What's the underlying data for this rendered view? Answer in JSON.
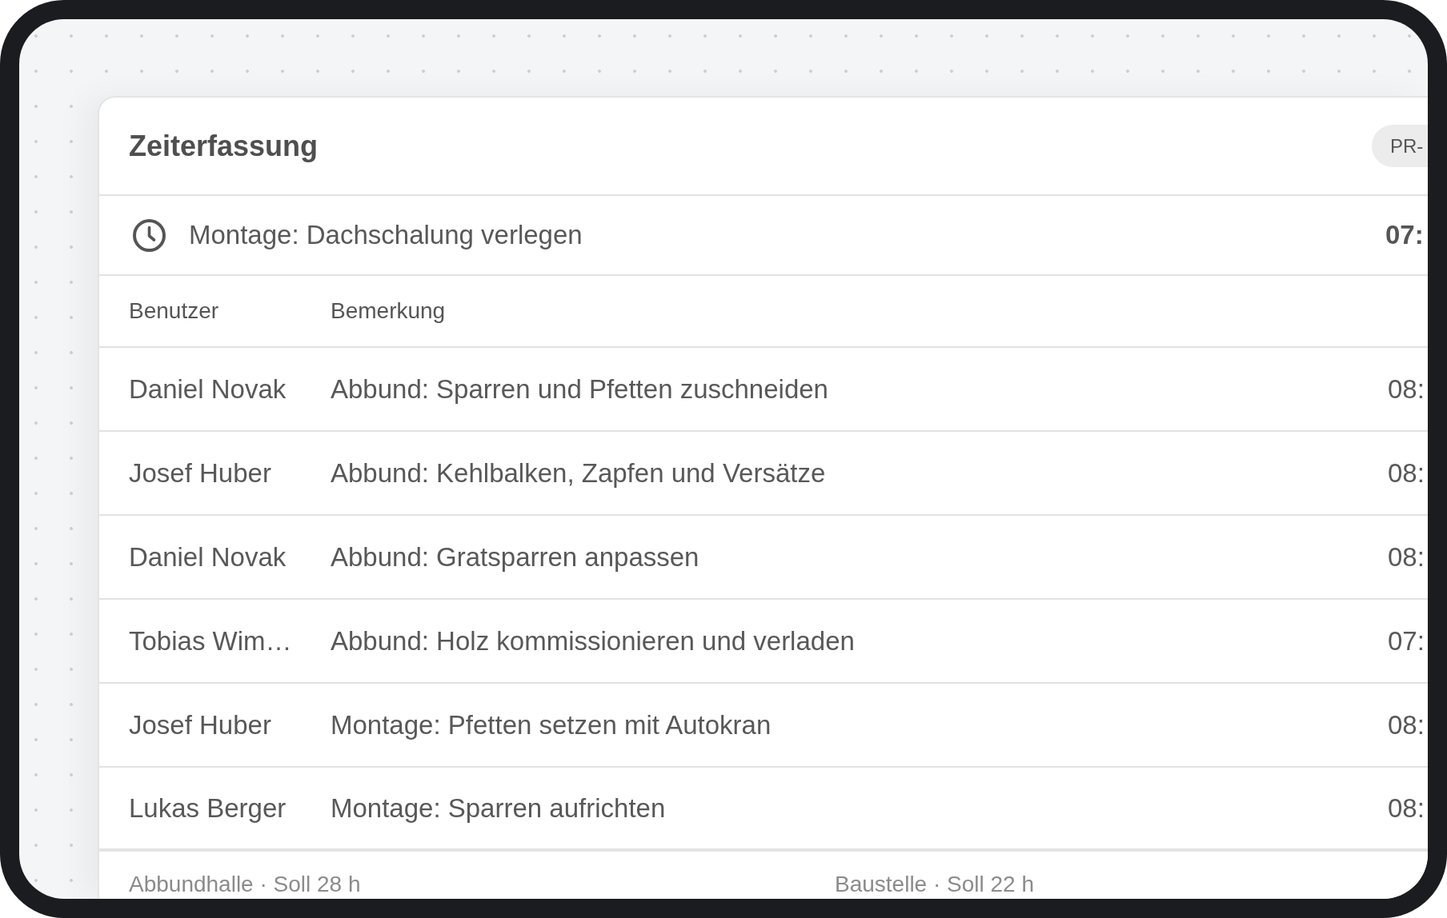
{
  "card": {
    "title": "Zeiterfassung",
    "badge": "PR-"
  },
  "task": {
    "title": "Montage: Dachschalung verlegen",
    "time": "07:"
  },
  "table": {
    "columns": [
      "Benutzer",
      "Bemerkung"
    ],
    "rows": [
      {
        "user": "Daniel Novak",
        "remark": "Abbund: Sparren und Pfetten zuschneiden",
        "column_3": "08:"
      },
      {
        "user": "Josef Huber",
        "remark": "Abbund: Kehlbalken, Zapfen und Versätze",
        "column_3": "08:"
      },
      {
        "user": "Daniel Novak",
        "remark": "Abbund: Gratsparren anpassen",
        "column_3": "08:"
      },
      {
        "user": "Tobias Wim…",
        "remark": "Abbund: Holz kommissionieren und verladen",
        "column_3": "07:"
      },
      {
        "user": "Josef Huber",
        "remark": "Montage: Pfetten setzen mit Autokran",
        "column_3": "08:"
      },
      {
        "user": "Lukas Berger",
        "remark": "Montage: Sparren aufrichten",
        "column_3": "08:"
      }
    ]
  },
  "footer": [
    "Abbundhalle · Soll 28 h",
    "Baustelle · Soll 22 h"
  ]
}
